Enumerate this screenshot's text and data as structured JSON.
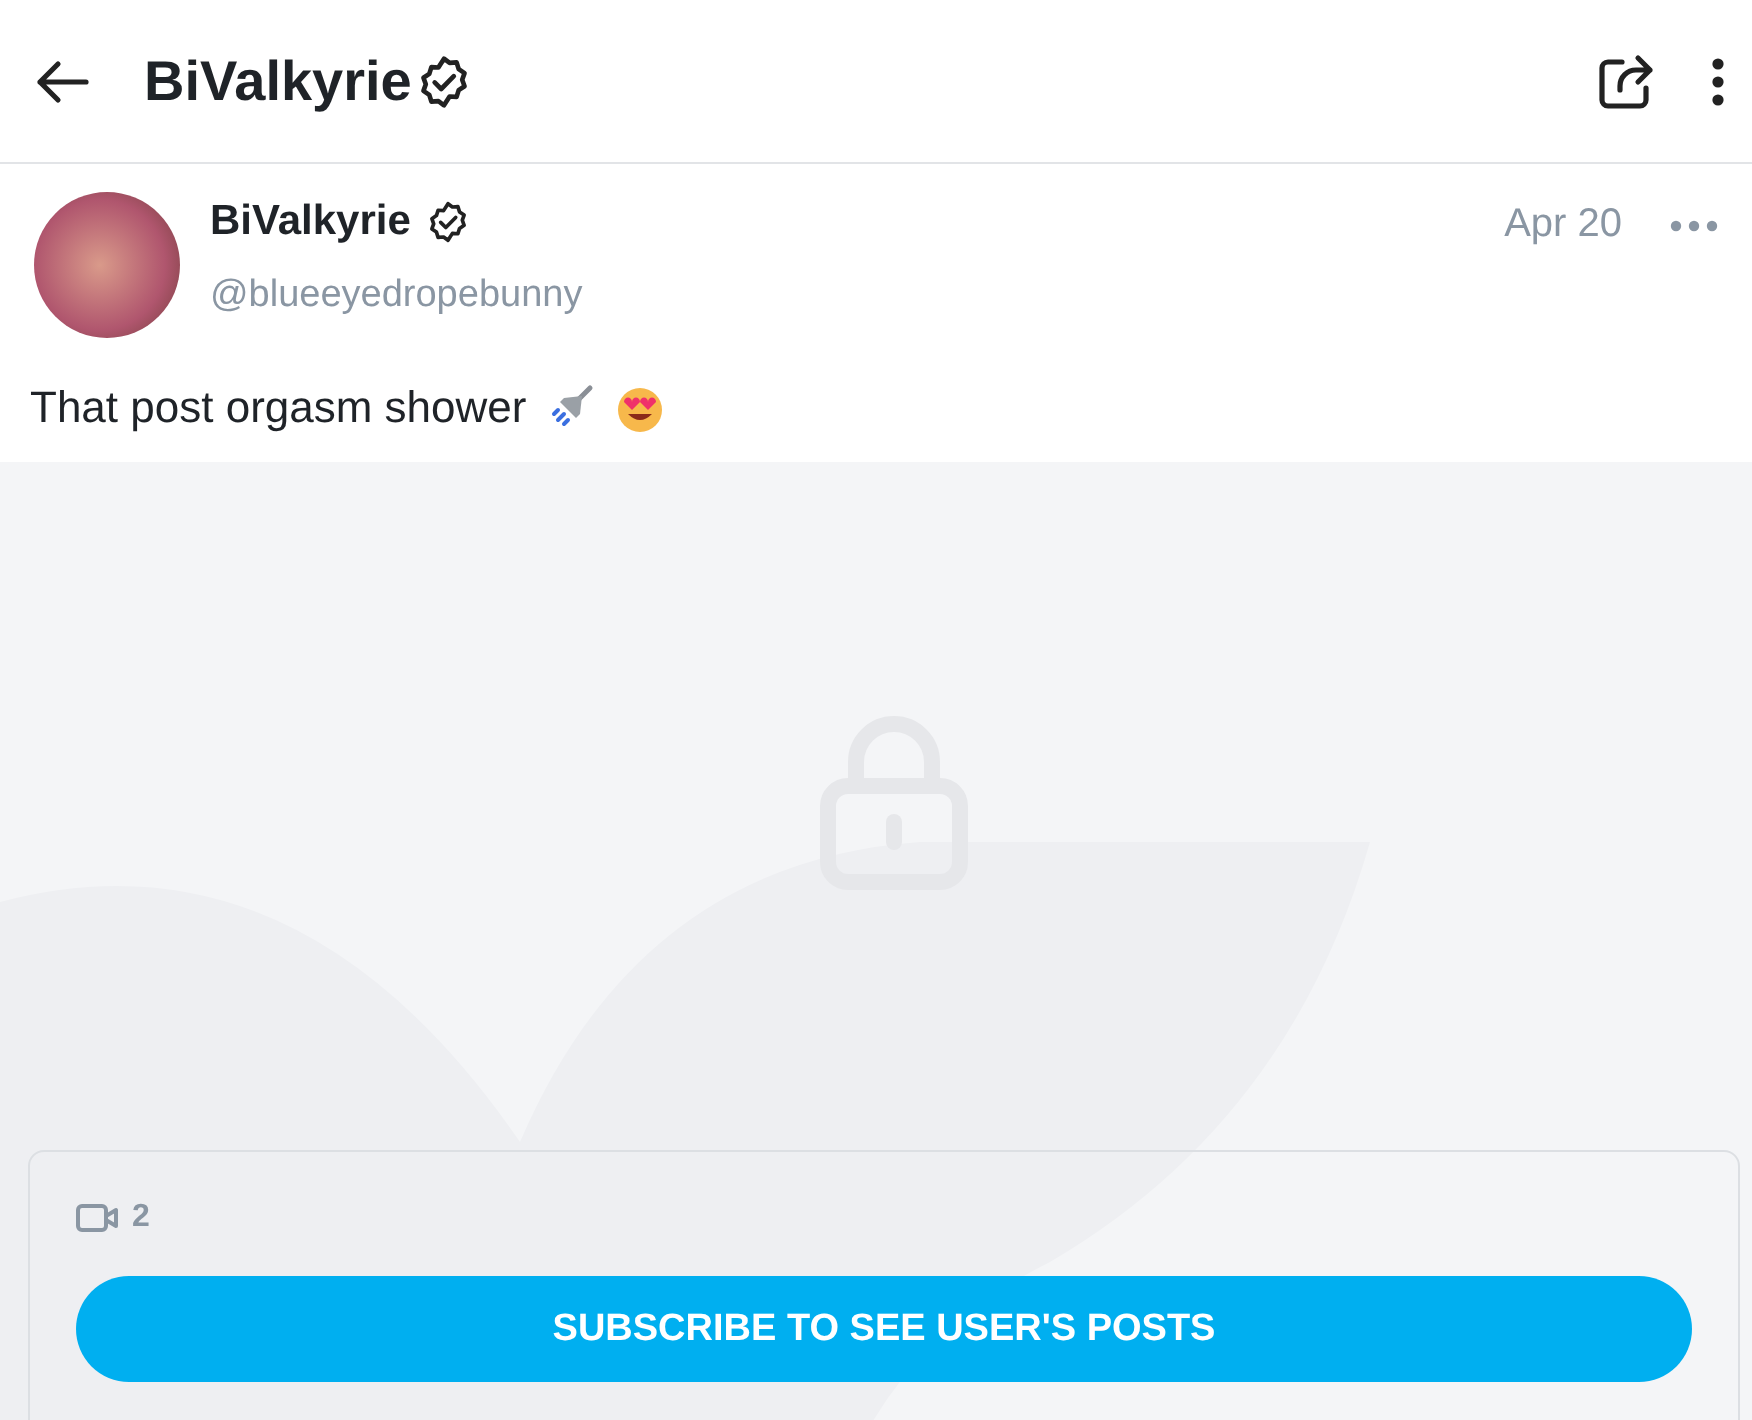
{
  "header": {
    "title": "BiValkyrie"
  },
  "post": {
    "author": "BiValkyrie",
    "handle": "@blueeyedropebunny",
    "date": "Apr 20",
    "text": "That post orgasm shower"
  },
  "locked": {
    "video_count": "2",
    "button": "SUBSCRIBE TO SEE USER'S POSTS"
  }
}
